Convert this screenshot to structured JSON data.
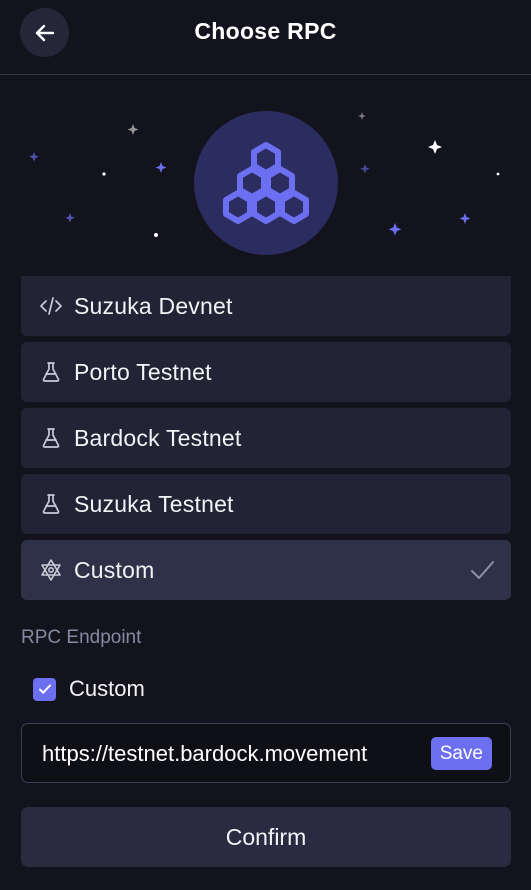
{
  "header": {
    "title": "Choose RPC",
    "back_icon": "arrow-left-icon"
  },
  "hero": {
    "logo_icon": "hexagon-cluster-logo",
    "accent": "#6c6ff0"
  },
  "networks": [
    {
      "label": "Suzuka Devnet",
      "icon": "code-icon",
      "selected": false
    },
    {
      "label": "Porto Testnet",
      "icon": "flask-icon",
      "selected": false
    },
    {
      "label": "Bardock Testnet",
      "icon": "flask-icon",
      "selected": false
    },
    {
      "label": "Suzuka Testnet",
      "icon": "flask-icon",
      "selected": false
    },
    {
      "label": "Custom",
      "icon": "hexagram-icon",
      "selected": true
    }
  ],
  "endpoint": {
    "section_label": "RPC Endpoint",
    "checkbox_label": "Custom",
    "checkbox_checked": true,
    "value": "https://testnet.bardock.movement",
    "save_label": "Save"
  },
  "confirm_label": "Confirm"
}
